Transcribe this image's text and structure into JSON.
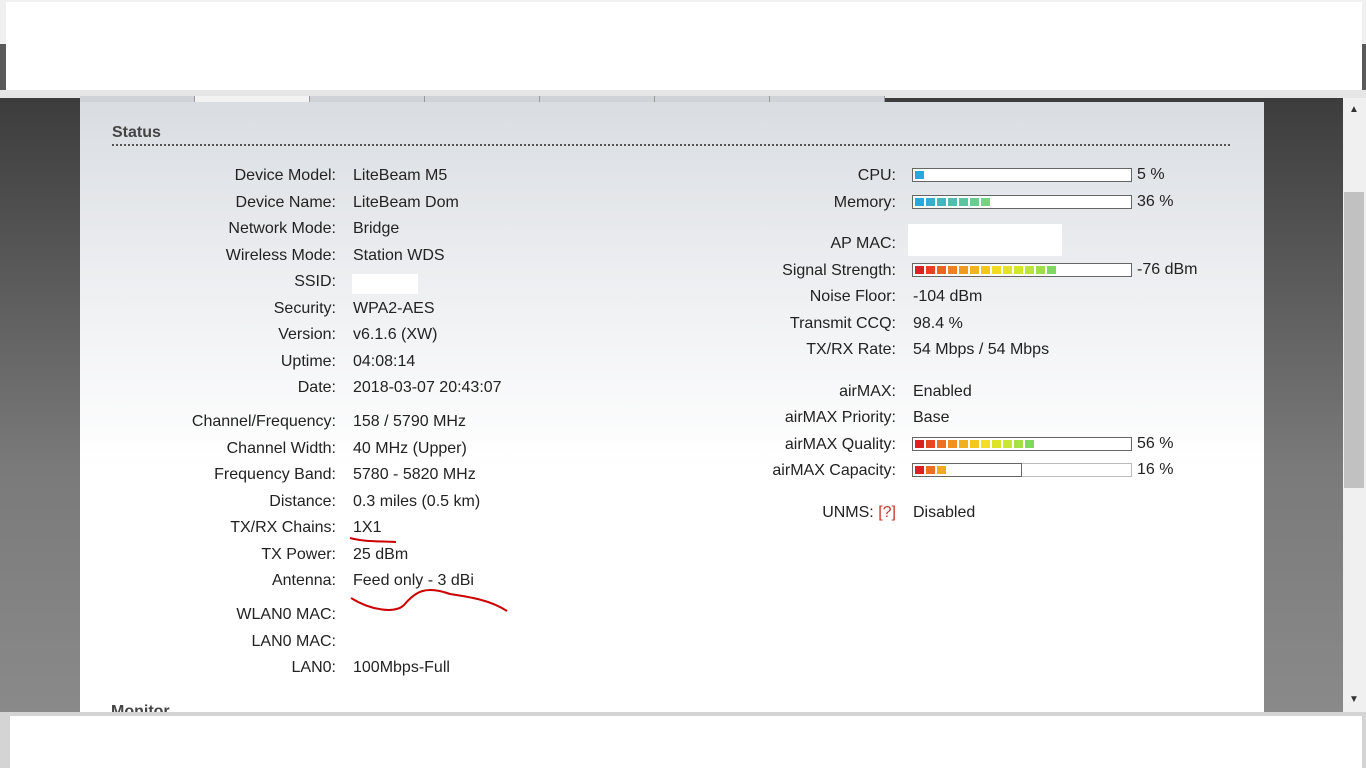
{
  "section_title": "Status",
  "next_section_title": "Monitor",
  "left_info": [
    {
      "label": "Device Model:",
      "value": "LiteBeam M5"
    },
    {
      "label": "Device Name:",
      "value": "LiteBeam Dom"
    },
    {
      "label": "Network Mode:",
      "value": "Bridge"
    },
    {
      "label": "Wireless Mode:",
      "value": "Station WDS"
    },
    {
      "label": "SSID:",
      "value": ""
    },
    {
      "label": "Security:",
      "value": "WPA2-AES"
    },
    {
      "label": "Version:",
      "value": "v6.1.6 (XW)"
    },
    {
      "label": "Uptime:",
      "value": "04:08:14"
    },
    {
      "label": "Date:",
      "value": "2018-03-07 20:43:07"
    },
    {
      "label": "Channel/Frequency:",
      "value": "158 / 5790 MHz"
    },
    {
      "label": "Channel Width:",
      "value": "40 MHz (Upper)"
    },
    {
      "label": "Frequency Band:",
      "value": "5780 - 5820 MHz"
    },
    {
      "label": "Distance:",
      "value": "0.3 miles (0.5 km)"
    },
    {
      "label": "TX/RX Chains:",
      "value": "1X1"
    },
    {
      "label": "TX Power:",
      "value": "25 dBm"
    },
    {
      "label": "Antenna:",
      "value": "Feed only - 3 dBi"
    },
    {
      "label": "WLAN0 MAC:",
      "value": ""
    },
    {
      "label": "LAN0 MAC:",
      "value": ""
    },
    {
      "label": "LAN0:",
      "value": "100Mbps-Full"
    }
  ],
  "right_info": {
    "cpu": {
      "label": "CPU:",
      "text": "5 %",
      "level_percent": 5
    },
    "memory": {
      "label": "Memory:",
      "text": "36 %",
      "level_percent": 36
    },
    "ap_mac": {
      "label": "AP MAC:",
      "value": ""
    },
    "signal_strength": {
      "label": "Signal Strength:",
      "text": "-76 dBm",
      "level_percent": 66
    },
    "noise_floor": {
      "label": "Noise Floor:",
      "value": "-104 dBm"
    },
    "transmit_ccq": {
      "label": "Transmit CCQ:",
      "value": "98.4 %"
    },
    "txrx_rate": {
      "label": "TX/RX Rate:",
      "value": "54 Mbps / 54 Mbps"
    },
    "airmax": {
      "label": "airMAX:",
      "value": "Enabled"
    },
    "airmax_priority": {
      "label": "airMAX Priority:",
      "value": "Base"
    },
    "airmax_quality": {
      "label": "airMAX Quality:",
      "text": "56 %",
      "level_percent": 56
    },
    "airmax_capacity": {
      "label": "airMAX Capacity:",
      "text": "16 %",
      "level_percent": 16
    },
    "unms": {
      "label": "UNMS:",
      "help": "[?]",
      "value": "Disabled"
    }
  },
  "colors": {
    "cpu_bar": "#29a8dc",
    "memory_bar_start": "#29a8dc",
    "memory_bar_end": "#7bd67b",
    "signal_gradient": [
      "#e02020",
      "#f07020",
      "#f0b020",
      "#f0e020",
      "#c8e830",
      "#80d860"
    ],
    "annotation_red": "#cc0000",
    "help_link": "#c0392b"
  }
}
